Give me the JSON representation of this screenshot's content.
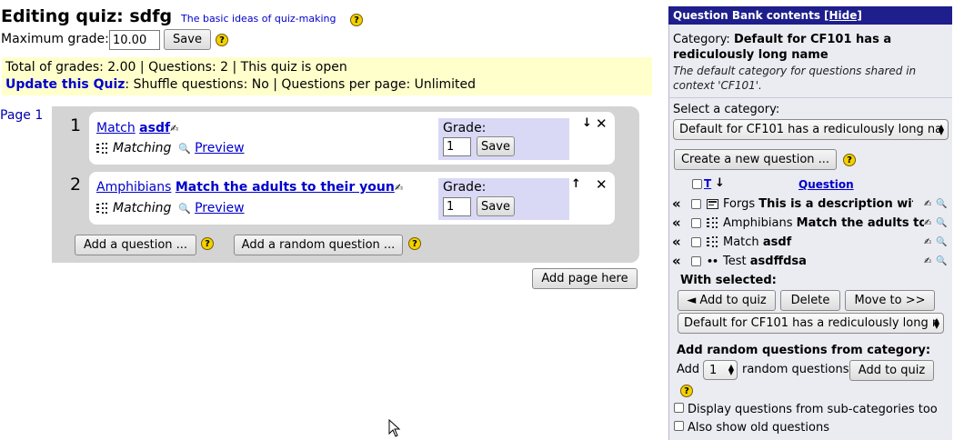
{
  "header": {
    "title": "Editing quiz: sdfg",
    "help_link": "The basic ideas of quiz-making",
    "max_grade_label": "Maximum grade:",
    "max_grade_value": "10.00",
    "save_label": "Save"
  },
  "info": {
    "line1": "Total of grades: 2.00 | Questions: 2 | This quiz is open",
    "update_link": "Update this Quiz",
    "line2_rest": ": Shuffle questions: No | Questions per page: Unlimited"
  },
  "page": {
    "label": "Page 1",
    "add_question": "Add a question ...",
    "add_random": "Add a random question ...",
    "add_page": "Add page here"
  },
  "questions": [
    {
      "num": "1",
      "link1": "Match",
      "link2": "asdf",
      "type": "Matching",
      "preview": "Preview",
      "grade_label": "Grade:",
      "grade_value": "1",
      "save": "Save"
    },
    {
      "num": "2",
      "link1": "Amphibians",
      "link2": "Match the adults to their youn",
      "type": "Matching",
      "preview": "Preview",
      "grade_label": "Grade:",
      "grade_value": "1",
      "save": "Save"
    }
  ],
  "bank": {
    "title": "Question Bank contents",
    "hide": "[Hide]",
    "category_prefix": "Category: ",
    "category_name": "Default for CF101 has a rediculously long name",
    "category_desc": "The default category for questions shared in context 'CF101'.",
    "select_label": "Select a category:",
    "select_value": "Default for CF101 has a rediculously long na",
    "create_new": "Create a new question ...",
    "col_t": "T",
    "col_question": "Question",
    "rows": [
      {
        "icon": "description",
        "type": "Forgs",
        "name": "This is a description with"
      },
      {
        "icon": "matching",
        "type": "Amphibians",
        "name": "Match the adults to"
      },
      {
        "icon": "matching",
        "type": "Match",
        "name": "asdf"
      },
      {
        "icon": "multichoice",
        "type": "Test",
        "name": "asdffdsa"
      }
    ],
    "with_selected": "With selected:",
    "add_to_quiz": "◄ Add to quiz",
    "delete": "Delete",
    "move_to": "Move to >>",
    "move_select": "Default for CF101 has a rediculously long n",
    "random_heading": "Add random questions from category:",
    "add_word": "Add",
    "random_count": "1",
    "random_questions": "random questions",
    "add_to_quiz2": "Add to quiz",
    "subcat_label": "Display questions from sub-categories too",
    "old_label": "Also show old questions"
  }
}
